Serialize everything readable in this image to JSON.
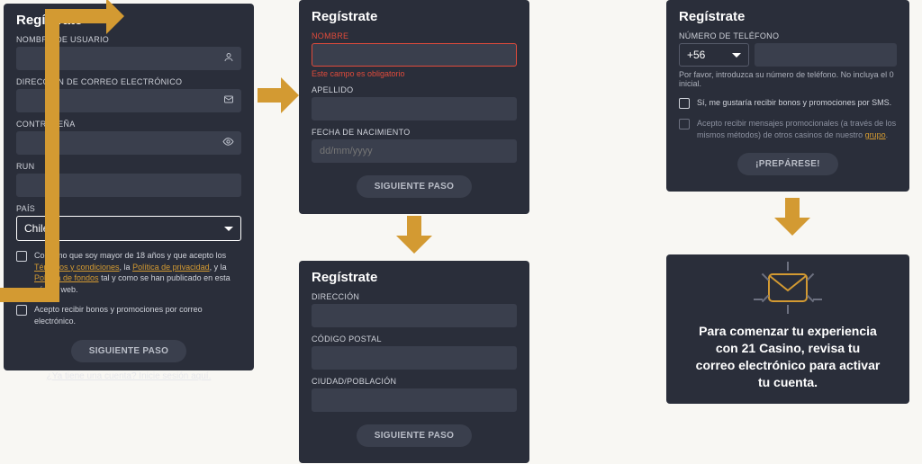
{
  "step1": {
    "title": "Regístrate",
    "username_label": "NOMBRE DE USUARIO",
    "email_label": "DIRECCIÓN DE CORREO ELECTRÓNICO",
    "password_label": "CONTRASEÑA",
    "run_label": "RUN",
    "country_label": "PAÍS",
    "country_value": "Chile",
    "terms_prefix": "Confirmo que soy mayor de 18 años y que acepto los ",
    "terms_link1": "Términos y condiciones",
    "terms_sep1": ", la ",
    "terms_link2": "Política de privacidad",
    "terms_sep2": ", y la ",
    "terms_link3": "Política de fondos",
    "terms_suffix": " tal y como se han publicado en esta página web.",
    "promo_email": "Acepto recibir bonos y promociones por correo electrónico.",
    "next": "SIGUIENTE PASO",
    "login_link": "¿Ya tiene una cuenta? Inicie sesión aquí."
  },
  "step2": {
    "title": "Regístrate",
    "name_label": "NOMBRE",
    "name_error": "Este campo es obligatorio",
    "lastname_label": "APELLIDO",
    "dob_label": "FECHA DE NACIMIENTO",
    "dob_placeholder": "dd/mm/yyyy",
    "next": "SIGUIENTE PASO"
  },
  "step3": {
    "title": "Regístrate",
    "address_label": "DIRECCIÓN",
    "zip_label": "CÓDIGO POSTAL",
    "city_label": "CIUDAD/POBLACIÓN",
    "next": "SIGUIENTE PASO"
  },
  "step4": {
    "title": "Regístrate",
    "phone_label": "NÚMERO DE TELÉFONO",
    "phone_prefix": "+56",
    "phone_help": "Por favor, introduzca su número de teléfono. No incluya el 0 inicial.",
    "sms_opt": "Sí, me gustaría recibir bonos y promociones por SMS.",
    "group_prefix": "Acepto recibir mensajes promocionales (a través de los mismos métodos) de otros casinos de nuestro ",
    "group_link": "grupo",
    "group_suffix": ".",
    "submit": "¡PREPÁRESE!"
  },
  "step5": {
    "message": "Para comenzar tu experiencia con 21 Casino, revisa tu correo electrónico para activar tu cuenta."
  }
}
